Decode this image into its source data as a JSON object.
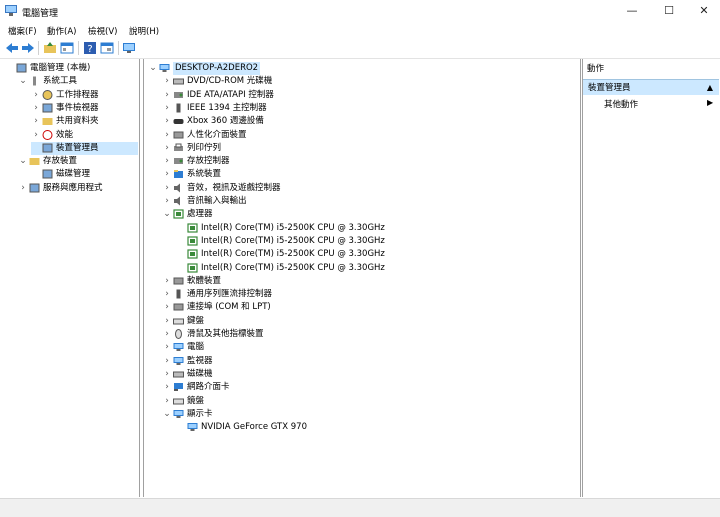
{
  "window": {
    "title": "電腦管理",
    "minimize": "—",
    "maximize": "☐",
    "close": "✕"
  },
  "menu": [
    "檔案(F)",
    "動作(A)",
    "檢視(V)",
    "說明(H)"
  ],
  "toolbar": [
    "back-arrow-icon",
    "forward-arrow-icon",
    "up-folder-icon",
    "show-tree-icon",
    "help-icon",
    "properties-icon",
    "monitor-icon"
  ],
  "left_tree": [
    {
      "label": "電腦管理 (本機)",
      "level": 0,
      "icon": "computer-management-icon",
      "chev": ""
    },
    {
      "label": "系統工具",
      "level": 1,
      "icon": "tools-icon",
      "chev": "v"
    },
    {
      "label": "工作排程器",
      "level": 2,
      "icon": "clock-icon",
      "chev": ">"
    },
    {
      "label": "事件檢視器",
      "level": 2,
      "icon": "event-viewer-icon",
      "chev": ">"
    },
    {
      "label": "共用資料夾",
      "level": 2,
      "icon": "shared-folder-icon",
      "chev": ">"
    },
    {
      "label": "效能",
      "level": 2,
      "icon": "performance-icon",
      "chev": ">"
    },
    {
      "label": "裝置管理員",
      "level": 2,
      "icon": "device-manager-icon",
      "chev": "",
      "selected": true
    },
    {
      "label": "存放裝置",
      "level": 1,
      "icon": "storage-icon",
      "chev": "v"
    },
    {
      "label": "磁碟管理",
      "level": 2,
      "icon": "disk-management-icon",
      "chev": ""
    },
    {
      "label": "服務與應用程式",
      "level": 1,
      "icon": "services-icon",
      "chev": ">"
    }
  ],
  "device_tree": [
    {
      "label": "DESKTOP-A2DERO2",
      "level": 0,
      "icon": "computer-icon",
      "chev": "v",
      "root": true
    },
    {
      "label": "DVD/CD-ROM 光碟機",
      "level": 1,
      "icon": "dvd-drive-icon",
      "chev": ">"
    },
    {
      "label": "IDE ATA/ATAPI 控制器",
      "level": 1,
      "icon": "ide-controller-icon",
      "chev": ">"
    },
    {
      "label": "IEEE 1394 主控制器",
      "level": 1,
      "icon": "firewire-icon",
      "chev": ">"
    },
    {
      "label": "Xbox 360 週邊設備",
      "level": 1,
      "icon": "gamepad-icon",
      "chev": ">"
    },
    {
      "label": "人性化介面裝置",
      "level": 1,
      "icon": "hid-icon",
      "chev": ">"
    },
    {
      "label": "列印佇列",
      "level": 1,
      "icon": "printer-icon",
      "chev": ">"
    },
    {
      "label": "存放控制器",
      "level": 1,
      "icon": "storage-controller-icon",
      "chev": ">"
    },
    {
      "label": "系統裝置",
      "level": 1,
      "icon": "system-devices-icon",
      "chev": ">"
    },
    {
      "label": "音效，視訊及遊戲控制器",
      "level": 1,
      "icon": "speaker-icon",
      "chev": ">"
    },
    {
      "label": "音訊輸入與輸出",
      "level": 1,
      "icon": "audio-io-icon",
      "chev": ">"
    },
    {
      "label": "處理器",
      "level": 1,
      "icon": "processor-icon",
      "chev": "v"
    },
    {
      "label": "Intel(R) Core(TM) i5-2500K CPU @ 3.30GHz",
      "level": 2,
      "icon": "processor-icon",
      "chev": ""
    },
    {
      "label": "Intel(R) Core(TM) i5-2500K CPU @ 3.30GHz",
      "level": 2,
      "icon": "processor-icon",
      "chev": ""
    },
    {
      "label": "Intel(R) Core(TM) i5-2500K CPU @ 3.30GHz",
      "level": 2,
      "icon": "processor-icon",
      "chev": ""
    },
    {
      "label": "Intel(R) Core(TM) i5-2500K CPU @ 3.30GHz",
      "level": 2,
      "icon": "processor-icon",
      "chev": ""
    },
    {
      "label": "軟體裝置",
      "level": 1,
      "icon": "software-device-icon",
      "chev": ">"
    },
    {
      "label": "通用序列匯流排控制器",
      "level": 1,
      "icon": "usb-icon",
      "chev": ">"
    },
    {
      "label": "連接埠 (COM 和 LPT)",
      "level": 1,
      "icon": "port-icon",
      "chev": ">"
    },
    {
      "label": "鍵盤",
      "level": 1,
      "icon": "keyboard-icon",
      "chev": ">"
    },
    {
      "label": "滑鼠及其他指標裝置",
      "level": 1,
      "icon": "mouse-icon",
      "chev": ">"
    },
    {
      "label": "電腦",
      "level": 1,
      "icon": "computer-icon",
      "chev": ">"
    },
    {
      "label": "監視器",
      "level": 1,
      "icon": "monitor-icon",
      "chev": ">"
    },
    {
      "label": "磁碟機",
      "level": 1,
      "icon": "disk-drive-icon",
      "chev": ">"
    },
    {
      "label": "網路介面卡",
      "level": 1,
      "icon": "network-adapter-icon",
      "chev": ">"
    },
    {
      "label": "鏡盤",
      "level": 1,
      "icon": "keyboard-icon",
      "chev": ">"
    },
    {
      "label": "顯示卡",
      "level": 1,
      "icon": "display-adapter-icon",
      "chev": "v"
    },
    {
      "label": "NVIDIA GeForce GTX 970",
      "level": 2,
      "icon": "display-adapter-icon",
      "chev": ""
    }
  ],
  "actions": {
    "header": "動作",
    "section": "裝置管理員",
    "more": "其他動作"
  },
  "colors": {
    "selection": "#cce8ff",
    "icon_blue": "#2d7dd2",
    "icon_green": "#3a8a3a"
  }
}
